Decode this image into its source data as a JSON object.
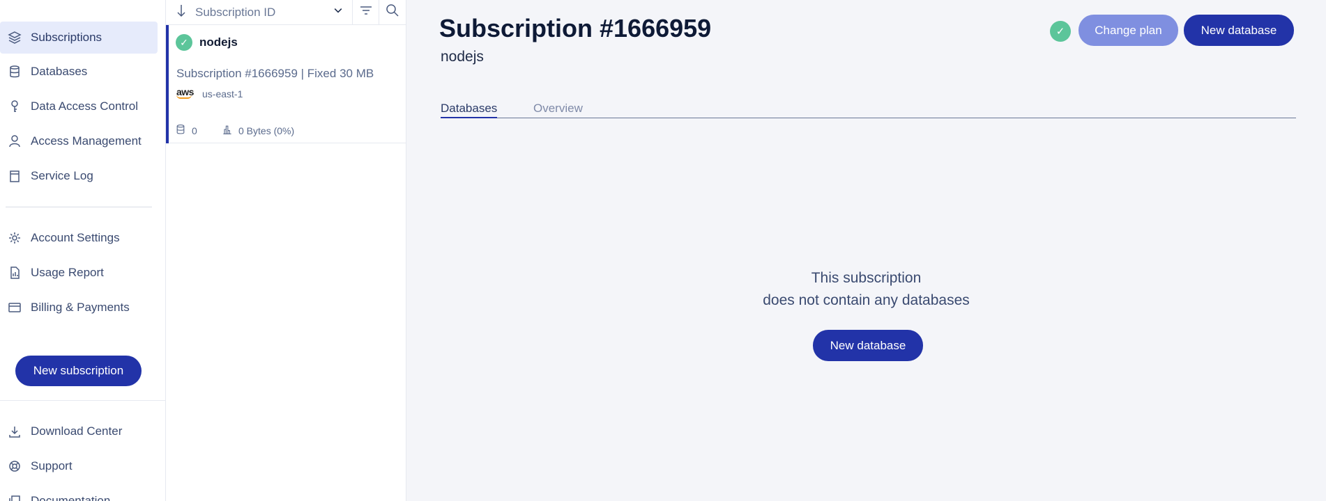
{
  "sidebar": {
    "items": [
      {
        "label": "Subscriptions",
        "icon": "layers-icon"
      },
      {
        "label": "Databases",
        "icon": "database-icon"
      },
      {
        "label": "Data Access Control",
        "icon": "key-icon"
      },
      {
        "label": "Access Management",
        "icon": "user-icon"
      },
      {
        "label": "Service Log",
        "icon": "log-icon"
      },
      {
        "label": "Account Settings",
        "icon": "gear-icon"
      },
      {
        "label": "Usage Report",
        "icon": "report-icon"
      },
      {
        "label": "Billing & Payments",
        "icon": "credit-card-icon"
      },
      {
        "label": "Download Center",
        "icon": "download-icon"
      },
      {
        "label": "Support",
        "icon": "lifebuoy-icon"
      },
      {
        "label": "Documentation",
        "icon": "docs-icon"
      }
    ],
    "new_subscription_label": "New subscription"
  },
  "list": {
    "sort_label": "Subscription ID",
    "subscription": {
      "name": "nodejs",
      "description": "Subscription #1666959 | Fixed 30 MB",
      "provider": "aws",
      "region": "us-east-1",
      "db_count": "0",
      "usage": "0 Bytes (0%)"
    }
  },
  "main": {
    "title": "Subscription #1666959",
    "subtitle": "nodejs",
    "change_plan_label": "Change plan",
    "new_database_label": "New database",
    "tabs": [
      {
        "label": "Databases",
        "active": true
      },
      {
        "label": "Overview",
        "active": false
      }
    ],
    "empty_line1": "This subscription",
    "empty_line2": "does not contain any databases",
    "empty_button_label": "New database"
  },
  "colors": {
    "accent": "#2233a8",
    "accent_light": "#7f8fe0",
    "success": "#5cc59a"
  }
}
